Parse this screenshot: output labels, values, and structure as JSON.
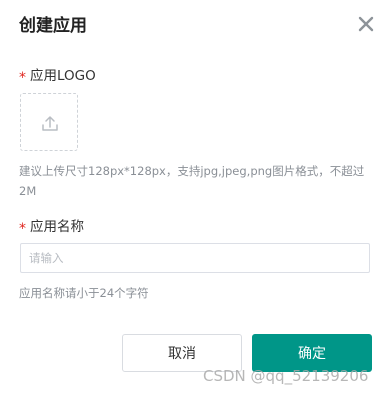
{
  "dialog": {
    "title": "创建应用",
    "close_icon": "close-icon"
  },
  "logo_field": {
    "required_mark": "*",
    "label": "应用LOGO",
    "upload_icon": "upload-icon",
    "hint": "建议上传尺寸128px*128px，支持jpg,jpeg,png图片格式，不超过2M"
  },
  "name_field": {
    "required_mark": "*",
    "label": "应用名称",
    "placeholder": "请输入",
    "value": "",
    "hint": "应用名称请小于24个字符"
  },
  "actions": {
    "cancel_label": "取消",
    "confirm_label": "确定"
  },
  "watermark": "CSDN @qq_52139206",
  "colors": {
    "primary": "#009688",
    "required": "#e0261f",
    "hint_text": "#8a8f96"
  }
}
